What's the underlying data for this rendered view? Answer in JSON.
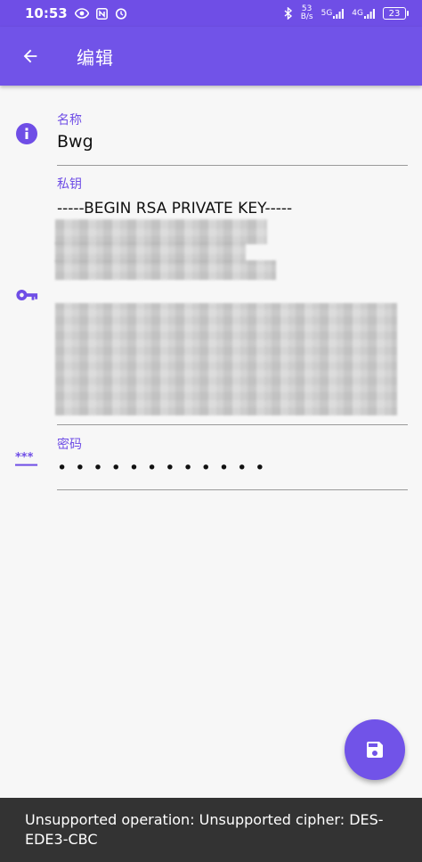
{
  "status_bar": {
    "time": "10:53",
    "net_speed_value": "53",
    "net_speed_unit": "B/s",
    "sig1": "5G",
    "sig2": "4G",
    "battery": "23"
  },
  "app_bar": {
    "title": "编辑"
  },
  "form": {
    "name": {
      "label": "名称",
      "value": "Bwg"
    },
    "private_key": {
      "label": "私钥",
      "value_first_line": "-----BEGIN RSA PRIVATE KEY-----"
    },
    "password": {
      "label": "密码",
      "value": "••••••••••••"
    }
  },
  "snackbar": {
    "message": "Unsupported operation: Unsupported cipher: DES-EDE3-CBC"
  },
  "colors": {
    "primary": "#7153e8",
    "label": "#6f4ee6",
    "snackbar_bg": "#333333"
  },
  "icons": {
    "back": "arrow-back-icon",
    "info": "info-icon",
    "key": "key-icon",
    "password": "password-icon",
    "save": "save-icon"
  }
}
